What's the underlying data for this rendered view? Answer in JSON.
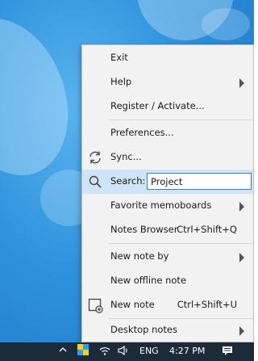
{
  "menu": {
    "exit": "Exit",
    "help": "Help",
    "register": "Register / Activate...",
    "preferences": "Preferences...",
    "sync": "Sync...",
    "search_label": "Search:",
    "search_value": "Project",
    "favorite_memoboards": "Favorite memoboards",
    "notes_browser": "Notes Browser",
    "notes_browser_shortcut": "Ctrl+Shift+Q",
    "new_note_by": "New note by",
    "new_offline_note": "New offline note",
    "new_note": "New note",
    "new_note_shortcut": "Ctrl+Shift+U",
    "desktop_notes": "Desktop notes"
  },
  "taskbar": {
    "language": "ENG",
    "time": "4:27 PM"
  },
  "icons": {
    "sync": "sync-icon",
    "search": "search-icon",
    "new_note": "new-note-icon",
    "up_arrow": "show-hidden-icons-icon",
    "app_tray": "tray-app-icon",
    "wifi": "wifi-icon",
    "volume": "volume-icon",
    "notifications": "notification-center-icon"
  },
  "colors": {
    "highlight": "#cfe4f7",
    "menu_bg": "#f2f2f2",
    "taskbar_bg": "#1c2b3a",
    "desktop": "#2f92dc"
  }
}
